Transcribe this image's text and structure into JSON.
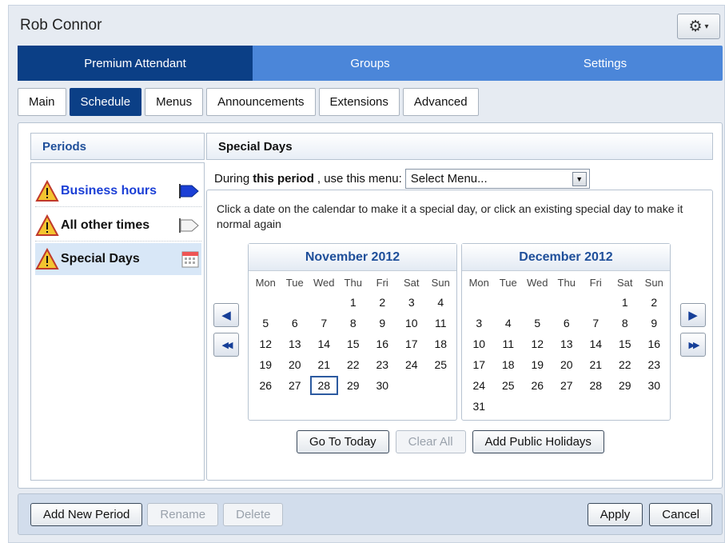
{
  "window": {
    "title": "Rob Connor",
    "gear_icon": "gear-icon",
    "gear_caret": "▾"
  },
  "topnav": [
    {
      "label": "Premium Attendant",
      "active": true
    },
    {
      "label": "Groups",
      "active": false
    },
    {
      "label": "Settings",
      "active": false
    }
  ],
  "subtabs": [
    {
      "label": "Main",
      "active": false
    },
    {
      "label": "Schedule",
      "active": true
    },
    {
      "label": "Menus",
      "active": false
    },
    {
      "label": "Announcements",
      "active": false
    },
    {
      "label": "Extensions",
      "active": false
    },
    {
      "label": "Advanced",
      "active": false
    }
  ],
  "periods": {
    "heading": "Periods",
    "items": [
      {
        "label": "Business hours",
        "icon": "flag-blue-icon"
      },
      {
        "label": "All other times",
        "icon": "flag-white-icon"
      },
      {
        "label": "Special Days",
        "icon": "calendar-icon",
        "selected": true
      }
    ]
  },
  "special": {
    "heading": "Special Days",
    "menu_prefix": "During",
    "menu_bold": "this period",
    "menu_suffix": ", use this menu:",
    "select_value": "Select Menu...",
    "instructions": "Click a date on the calendar to make it a special day, or click an existing special day to make it normal again"
  },
  "calendar": {
    "weekdays": [
      "Mon",
      "Tue",
      "Wed",
      "Thu",
      "Fri",
      "Sat",
      "Sun"
    ],
    "months": [
      {
        "title": "November 2012",
        "offset": 3,
        "days": 30,
        "today": 28
      },
      {
        "title": "December 2012",
        "offset": 5,
        "days": 31,
        "today": null
      }
    ],
    "buttons": {
      "go_today": "Go To Today",
      "clear_all": "Clear All",
      "add_holidays": "Add Public Holidays"
    },
    "nav": {
      "prev": "◀",
      "prev_year": "◀◀",
      "next": "▶",
      "next_year": "▶▶"
    }
  },
  "footer": {
    "add_period": "Add New Period",
    "rename": "Rename",
    "delete": "Delete",
    "apply": "Apply",
    "cancel": "Cancel"
  },
  "colors": {
    "nav_active": "#0b3f86",
    "nav": "#4b86d9",
    "link_blue": "#1b3fd6",
    "heading_blue": "#1f4f9a"
  }
}
